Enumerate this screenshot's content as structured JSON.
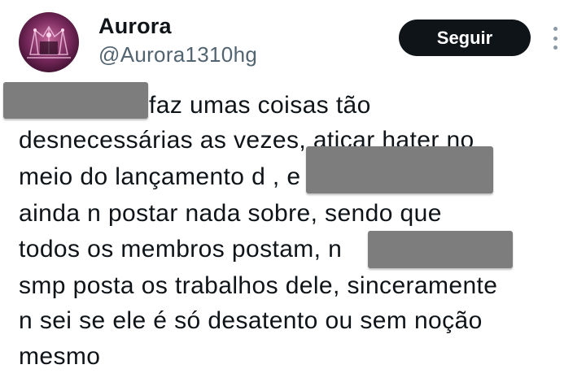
{
  "user": {
    "display_name": "Aurora",
    "handle": "@Aurora1310hg",
    "avatar_icon": "avatar-image"
  },
  "actions": {
    "follow_label": "Seguir",
    "more_icon": "more-vertical-icon"
  },
  "tweet": {
    "lines": [
      "faz umas coisas tão",
      "desnecessárias as vezes, atiçar hater no",
      "meio do lançamento d                        , e",
      "ainda n postar nada sobre, sendo que",
      "todos os membros postam,                      n",
      "smp posta os trabalhos dele, sinceramente",
      "n sei se ele é só desatento ou sem  noção",
      "mesmo"
    ]
  },
  "colors": {
    "text": "#0f1419",
    "handle": "#536471",
    "button_bg": "#0f1419",
    "redaction": "#7d7d7d"
  }
}
